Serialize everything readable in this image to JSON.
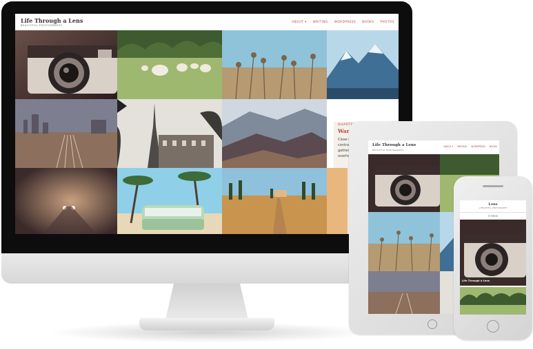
{
  "desktop": {
    "site_title": "Life Through a Lens",
    "site_tagline": "BEAUTIFUL PHOTOGRAPHY",
    "nav": [
      "ABOUT ▾",
      "WRITING",
      "WORDPRESS",
      "BOOKS",
      "PHOTOS"
    ],
    "feature": {
      "category": "QUARTERN",
      "title": "War of the Worlds",
      "excerpt_lines": [
        "Close on",
        "contrast",
        "gather",
        "overhea"
      ]
    }
  },
  "tablet": {
    "site_title": "Life Through a Lens",
    "site_tagline": "BEAUTIFUL PHOTOGRAPHY",
    "nav": [
      "ABOUT ▾",
      "WRITING",
      "WORDPRESS",
      "BOOKS"
    ]
  },
  "phone": {
    "site_title": "Lens",
    "site_tagline": "a BEAUTIFUL PHOTOGRAPHY",
    "menu_label": "☰ MENU",
    "photo_caption": "Life Through a Lens"
  },
  "photo_subjects": [
    "vintage-camera",
    "sheep-meadow",
    "dry-flowers",
    "snowy-mountains",
    "railway-tracks",
    "eiffel-tower",
    "mountain-ridges",
    "foggy-road",
    "palm-beach-van",
    "tuscan-cypress-road"
  ]
}
